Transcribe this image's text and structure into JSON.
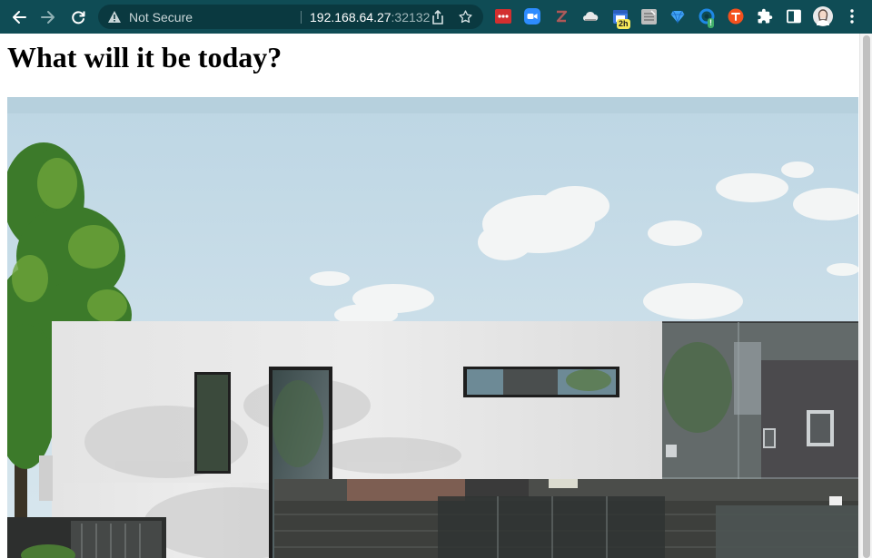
{
  "browser": {
    "security_label": "Not Secure",
    "url_host": "192.168.64.27",
    "url_port": ":32132",
    "icons": [
      "back-icon",
      "forward-icon",
      "reload-icon",
      "warning-icon",
      "share-icon",
      "bookmark-star-icon",
      "extensions-puzzle-icon",
      "side-panel-icon",
      "profile-avatar",
      "kebab-menu-icon"
    ],
    "extensions": [
      {
        "name": "lastpass-extension-icon",
        "color": "#d32f2f"
      },
      {
        "name": "zoom-extension-icon",
        "color": "#2d8cff"
      },
      {
        "name": "zotero-extension-icon",
        "color": "#c62828"
      },
      {
        "name": "cloud-extension-icon",
        "color": "#e0e0e0"
      },
      {
        "name": "calendar-extension-icon",
        "color": "#3d7be3",
        "badge": "2h"
      },
      {
        "name": "notes-extension-icon",
        "color": "#b0b0b0"
      },
      {
        "name": "gem-extension-icon",
        "color": "#42a5f5"
      },
      {
        "name": "sync-extension-icon",
        "color": "#1e88e5",
        "badge": "!"
      },
      {
        "name": "todoist-extension-icon",
        "color": "#f4511e"
      }
    ],
    "colors": {
      "toolbar": "#0f4c55",
      "omnibox": "#0a3940"
    }
  },
  "page": {
    "title": "What will it be today?",
    "hero_image": "modern-white-house-photo"
  }
}
